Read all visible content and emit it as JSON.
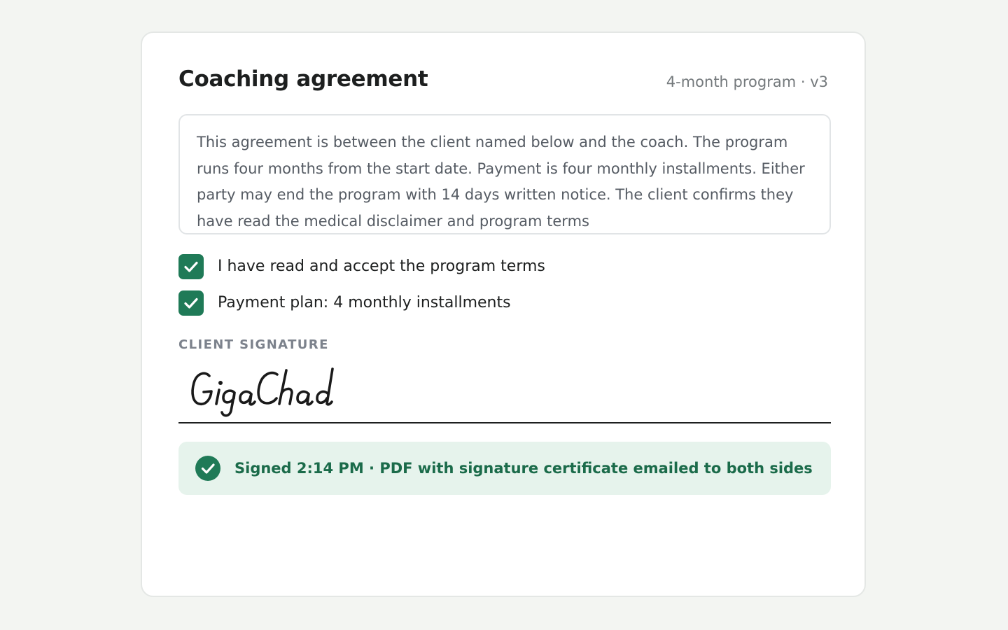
{
  "header": {
    "title": "Coaching agreement",
    "meta": "4-month program · v3"
  },
  "terms": {
    "text": "This agreement is between the client named below and the coach. The program runs four months from the start date. Payment is four monthly installments. Either party may end the program with 14 days written notice. The client confirms they have read the medical disclaimer and program terms"
  },
  "checkboxes": [
    {
      "label": "I have read and accept the program terms",
      "checked": true
    },
    {
      "label": "Payment plan: 4 monthly installments",
      "checked": true
    }
  ],
  "signature": {
    "label": "CLIENT SIGNATURE",
    "value": "GigaChad"
  },
  "status": {
    "text": "Signed 2:14 PM · PDF with signature certificate emailed to both sides"
  },
  "colors": {
    "accent": "#1f7a57",
    "status_bg": "#e6f3ec",
    "status_text": "#1b6b4a"
  }
}
